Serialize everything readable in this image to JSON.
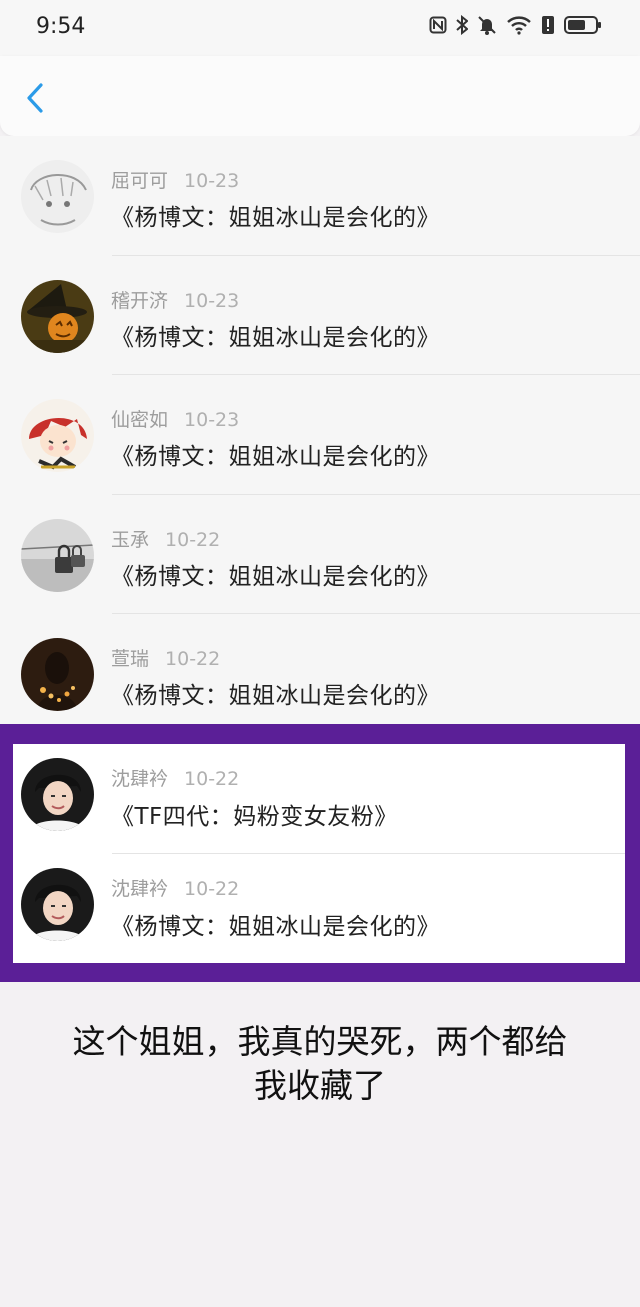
{
  "status_bar": {
    "time": "9:54"
  },
  "colors": {
    "highlight_border": "#5b1f97",
    "back_icon": "#2b9be8"
  },
  "comments": [
    {
      "name": "屈可可",
      "date": "10-23",
      "title": "《杨博文：姐姐冰山是会化的》",
      "avatar": "anime-sketch-avatar"
    },
    {
      "name": "稽开济",
      "date": "10-23",
      "title": "《杨博文：姐姐冰山是会化的》",
      "avatar": "pumpkin-witch-avatar"
    },
    {
      "name": "仙密如",
      "date": "10-23",
      "title": "《杨博文：姐姐冰山是会化的》",
      "avatar": "red-hair-girl-avatar"
    },
    {
      "name": "玉承",
      "date": "10-22",
      "title": "《杨博文：姐姐冰山是会化的》",
      "avatar": "padlock-avatar"
    },
    {
      "name": "萱瑞",
      "date": "10-22",
      "title": "《杨博文：姐姐冰山是会化的》",
      "avatar": "candlelight-avatar"
    }
  ],
  "highlighted": [
    {
      "name": "沈肆衿",
      "date": "10-22",
      "title": "《TF四代：妈粉变女友粉》",
      "avatar": "boy-photo-avatar"
    },
    {
      "name": "沈肆衿",
      "date": "10-22",
      "title": "《杨博文：姐姐冰山是会化的》",
      "avatar": "boy-photo-avatar"
    }
  ],
  "caption": {
    "line1": "这个姐姐，我真的哭死，两个都给",
    "line2": "我收藏了"
  }
}
